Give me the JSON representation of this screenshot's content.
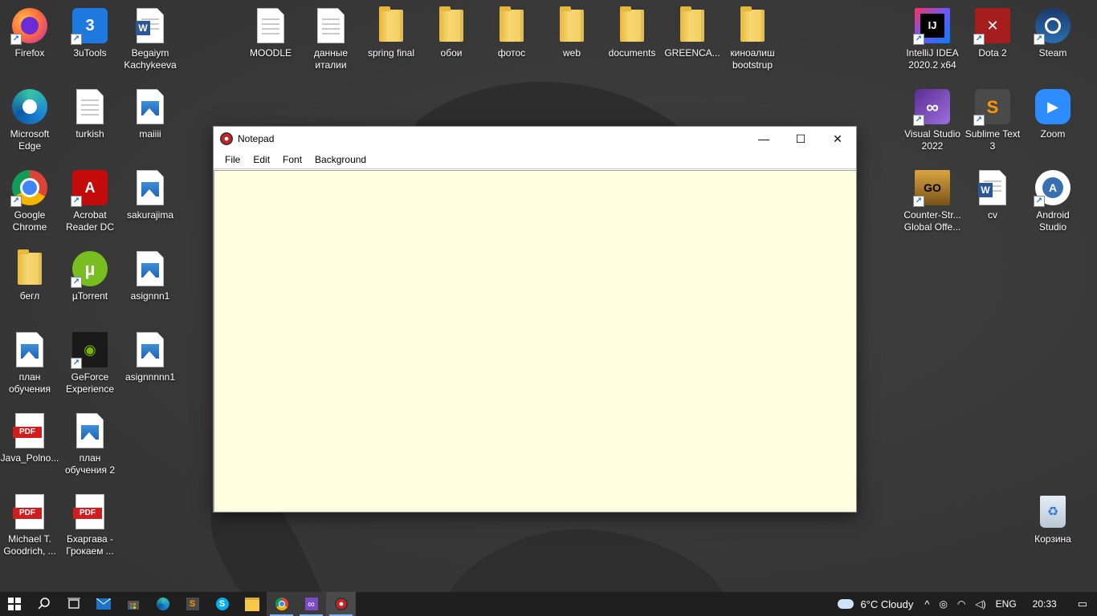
{
  "desktop": {
    "left_icons": [
      {
        "label": "Firefox"
      },
      {
        "label": "3uTools"
      },
      {
        "label": "Begaiym Kachykeeva"
      },
      {
        "label": "Microsoft Edge"
      },
      {
        "label": "turkish"
      },
      {
        "label": "maiiii"
      },
      {
        "label": "Google Chrome"
      },
      {
        "label": "Acrobat Reader DC"
      },
      {
        "label": "sakurajima"
      },
      {
        "label": "бегл"
      },
      {
        "label": "µTorrent"
      },
      {
        "label": "asignnn1"
      },
      {
        "label": "план обучения"
      },
      {
        "label": "GeForce Experience"
      },
      {
        "label": "asignnnnn1"
      },
      {
        "label": "Java_Polno..."
      },
      {
        "label": "план обучения 2"
      },
      {
        "label": "Michael T. Goodrich, ..."
      },
      {
        "label": "Бхаргава - Грокаем ..."
      }
    ],
    "top_icons": [
      {
        "label": "MOODLE"
      },
      {
        "label": "данные италии"
      },
      {
        "label": "spring final"
      },
      {
        "label": "обои"
      },
      {
        "label": "фотос"
      },
      {
        "label": "web"
      },
      {
        "label": "documents"
      },
      {
        "label": "GREENCA..."
      },
      {
        "label": "киноалиш bootstrup"
      }
    ],
    "right_icons": [
      {
        "label": "IntelliJ IDEA 2020.2 x64"
      },
      {
        "label": "Dota 2"
      },
      {
        "label": "Steam"
      },
      {
        "label": "Visual Studio 2022"
      },
      {
        "label": "Sublime Text 3"
      },
      {
        "label": "Zoom"
      },
      {
        "label": "Counter-Str... Global Offe..."
      },
      {
        "label": "cv"
      },
      {
        "label": "Android Studio"
      },
      {
        "label": "Корзина"
      }
    ]
  },
  "window": {
    "title": "Notepad",
    "minimize_symbol": "—",
    "maximize_symbol": "☐",
    "close_symbol": "✕",
    "menu": [
      "File",
      "Edit",
      "Font",
      "Background"
    ],
    "editor_value": "",
    "editor_bg": "#ffffe0"
  },
  "taskbar": {
    "weather": "6°C  Cloudy",
    "language": "ENG",
    "time": "20:33"
  }
}
